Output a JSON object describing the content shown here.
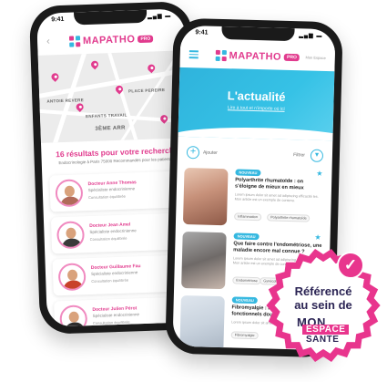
{
  "status_bar": {
    "time": "9:41"
  },
  "brand": {
    "name": "MAPATHO",
    "badge": "PRO",
    "colors": {
      "pink": "#e13b8e",
      "blue": "#35b8e0"
    }
  },
  "left_screen": {
    "map_labels": [
      "ANTOIE REVERE",
      "PLACE PEREIRE",
      "ENFANTS TRAVAIL",
      "3ÈME ARR"
    ],
    "results_title": "16 résultats pour votre recherche",
    "results_subtitle": "Endocrinologie à Paris 75000 Recommandés pour les patients",
    "doctors": [
      {
        "name": "Docteur Anne Thomas",
        "specialty": "Spécialiste endocrinienne",
        "address": "Consultation équilibrée",
        "avatar_color": "#b16b5a"
      },
      {
        "name": "Docteur Jean Amel",
        "specialty": "Spécialiste endocrinienne",
        "address": "Consultation équilibrée",
        "avatar_color": "#3a3a3a"
      },
      {
        "name": "Docteur Guillaume Fau",
        "specialty": "Spécialiste endocrinienne",
        "address": "Consultation équilibrée",
        "avatar_color": "#c8412a"
      },
      {
        "name": "Docteur Julien Pérot",
        "specialty": "Spécialiste endocrinienne",
        "address": "Consultation équilibrée",
        "avatar_color": "#2d2d2d"
      }
    ]
  },
  "right_screen": {
    "partner": "Mon Espace",
    "hero_title": "L'actualité",
    "hero_subtitle": "Lire à tout et n'importe où ici",
    "add_label": "Ajouter",
    "filter_label": "Filtrer",
    "articles": [
      {
        "tag": "NOUVEAU",
        "title": "Polyarthrite rhumatoïde : on s'éloigne de mieux en mieux",
        "excerpt": "Lorem ipsum dolor sit amet ad adipiscing efficacité les. Mon article est un exemple de contenu.",
        "chips": [
          "Inflammation",
          "Polyarthrite rhumatoïde"
        ]
      },
      {
        "tag": "NOUVEAU",
        "title": "Que faire contre l'endométriose, une maladie encore mal connue ?",
        "excerpt": "Lorem ipsum dolor sit amet ad adipiscing efficacité les. Mon article est un exemple de contenu.",
        "chips": [
          "Endométriose",
          "Gynécologie",
          "Santé"
        ]
      },
      {
        "tag": "NOUVEAU",
        "title": "Fibromyalgie : les troubles fonctionnels douleurs",
        "excerpt": "Lorem ipsum dolor sit amet ad adipiscing efficacité les.",
        "chips": [
          "Fibromyalgie"
        ]
      }
    ]
  },
  "badge": {
    "line1": "Référencé",
    "line2": "au sein de",
    "logo_word1": "MON",
    "logo_word2": "ESPACE",
    "logo_word3": "SANTE",
    "color": "#e8358d"
  }
}
